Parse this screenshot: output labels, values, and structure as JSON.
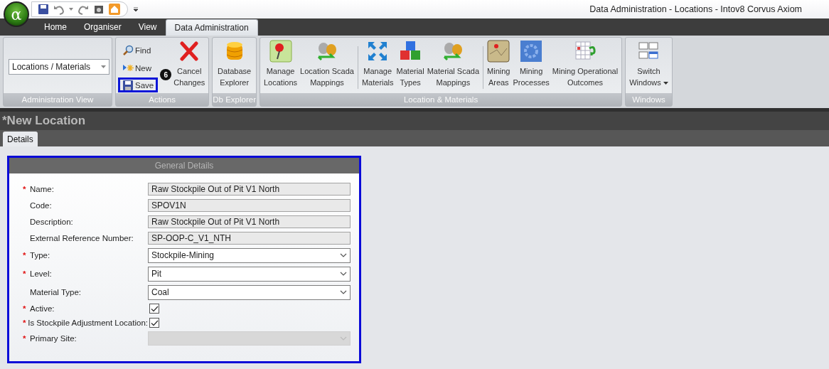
{
  "window": {
    "title": "Data Administration - Locations - Intov8 Corvus Axiom"
  },
  "app_button": {
    "symbol": "α"
  },
  "ribbon": {
    "tabs": [
      {
        "label": "Home",
        "selected": false
      },
      {
        "label": "Organiser",
        "selected": false
      },
      {
        "label": "View",
        "selected": false
      },
      {
        "label": "Data Administration",
        "selected": true
      }
    ],
    "groups": [
      {
        "title": "Administration View",
        "kind": "dropdown",
        "value": "Locations / Materials"
      },
      {
        "title": "Actions",
        "kind": "actions",
        "small_buttons": [
          {
            "label": "Find",
            "highlighted": false
          },
          {
            "label": "New",
            "highlighted": false
          },
          {
            "label": "Save",
            "highlighted": true,
            "callout": "6"
          }
        ],
        "buttons": [
          {
            "label": "Cancel\nChanges"
          }
        ]
      },
      {
        "title": "Db Explorer",
        "kind": "buttons",
        "sections": [
          [
            {
              "label": "Database\nExplorer"
            }
          ]
        ]
      },
      {
        "title": "Location & Materials",
        "kind": "buttons",
        "sections": [
          [
            {
              "label": "Manage\nLocations"
            },
            {
              "label": "Location Scada\nMappings"
            }
          ],
          [
            {
              "label": "Manage\nMaterials"
            },
            {
              "label": "Material\nTypes"
            },
            {
              "label": "Material Scada\nMappings"
            }
          ],
          [
            {
              "label": "Mining\nAreas"
            },
            {
              "label": "Mining\nProcesses"
            },
            {
              "label": "Mining Operational\nOutcomes"
            }
          ]
        ]
      },
      {
        "title": "Windows",
        "kind": "buttons",
        "sections": [
          [
            {
              "label": "Switch\nWindows",
              "menu": true
            }
          ]
        ]
      }
    ]
  },
  "page": {
    "title": "*New Location",
    "tabs": [
      {
        "label": "Details",
        "selected": true
      }
    ]
  },
  "panel": {
    "title": "General Details",
    "required_mark": "*",
    "fields": [
      {
        "label": "Name:",
        "required": true,
        "kind": "text",
        "value": "Raw Stockpile Out of Pit V1 North"
      },
      {
        "label": "Code:",
        "required": false,
        "kind": "text",
        "value": "SPOV1N"
      },
      {
        "label": "Description:",
        "required": false,
        "kind": "text",
        "value": "Raw Stockpile Out of Pit V1 North"
      },
      {
        "label": "External Reference Number:",
        "required": false,
        "kind": "text",
        "value": "SP-OOP-C_V1_NTH"
      },
      {
        "label": "Type:",
        "required": true,
        "kind": "select",
        "value": "Stockpile-Mining",
        "disabled": false
      },
      {
        "label": "Level:",
        "required": true,
        "kind": "select",
        "value": "Pit",
        "disabled": false
      },
      {
        "label": "Material Type:",
        "required": false,
        "kind": "select",
        "value": "Coal",
        "disabled": false
      },
      {
        "label": "Active:",
        "required": true,
        "kind": "checkbox",
        "checked": true
      },
      {
        "label": "Is Stockpile Adjustment Location:",
        "required": true,
        "kind": "checkbox",
        "checked": true
      },
      {
        "label": "Primary Site:",
        "required": true,
        "kind": "select",
        "disabled": true
      }
    ]
  }
}
